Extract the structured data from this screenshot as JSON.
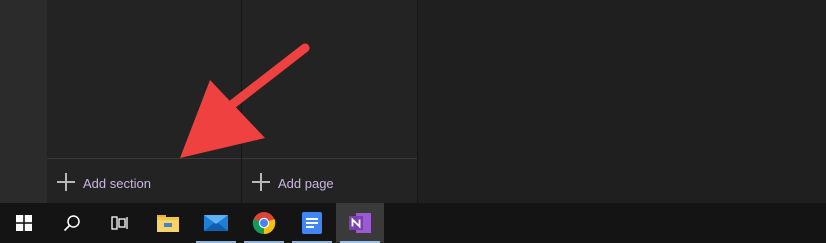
{
  "sections_pane": {
    "add_label": "Add section"
  },
  "pages_pane": {
    "add_label": "Add page"
  },
  "annotation": {
    "color": "#f04141"
  },
  "taskbar": {
    "start_icon": "windows-logo-icon",
    "search_icon": "search-icon",
    "task_view_icon": "task-view-icon",
    "apps": [
      {
        "name": "File Explorer",
        "icon": "folder-icon",
        "running": false
      },
      {
        "name": "Mail",
        "icon": "mail-icon",
        "running": true
      },
      {
        "name": "Google Chrome",
        "icon": "chrome-icon",
        "running": true
      },
      {
        "name": "Google Docs",
        "icon": "docs-icon",
        "running": true
      },
      {
        "name": "OneNote",
        "icon": "onenote-icon",
        "running": true,
        "active": true
      }
    ]
  },
  "colors": {
    "accent_label": "#c9b7df",
    "onenote_purple": "#7b3fb0",
    "taskbar_indicator": "#8fb3d9"
  }
}
